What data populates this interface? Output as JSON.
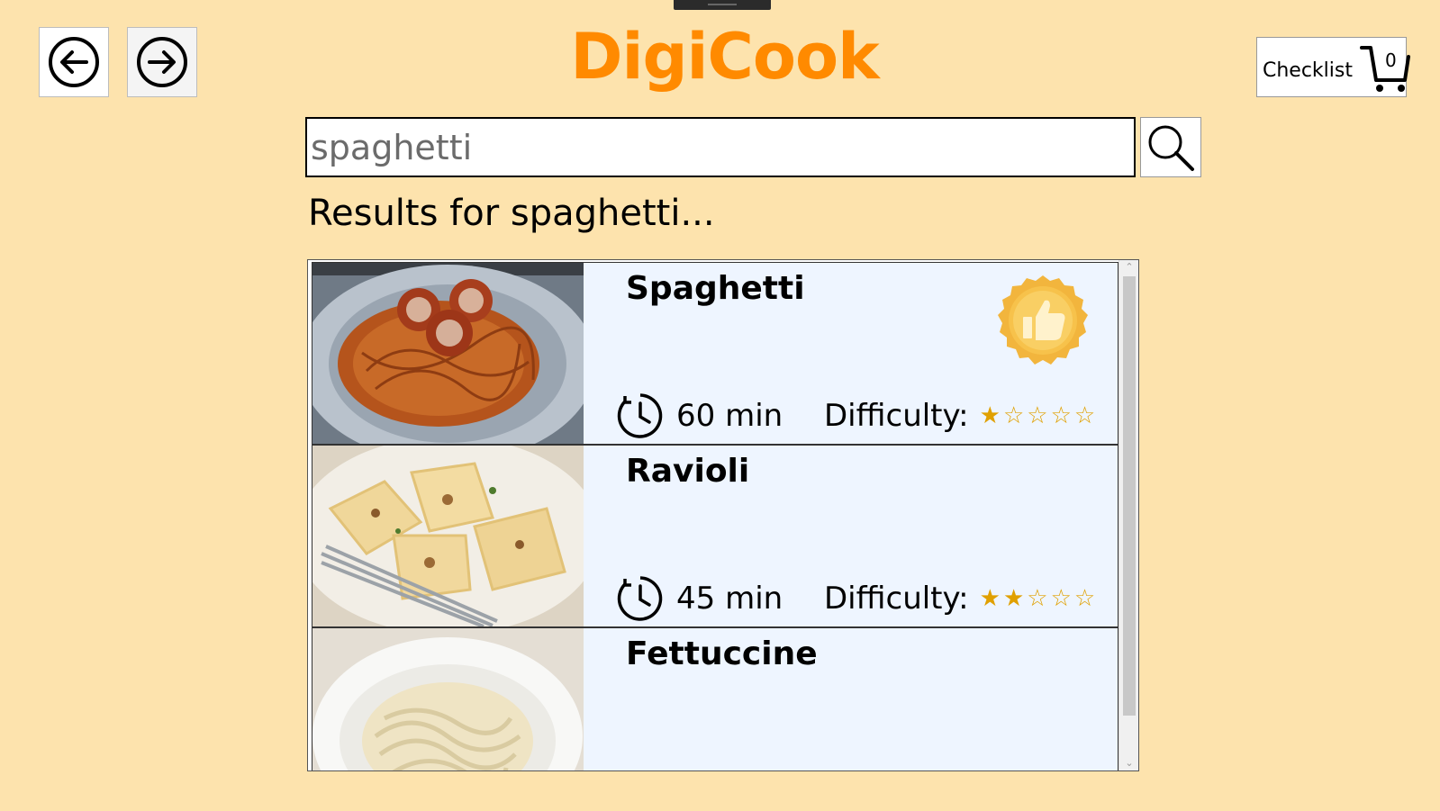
{
  "app": {
    "title": "DigiCook"
  },
  "nav": {
    "back_icon": "arrow-left-circle-icon",
    "forward_icon": "arrow-right-circle-icon"
  },
  "checklist": {
    "label": "Checklist",
    "count": "0",
    "icon": "shopping-cart-icon"
  },
  "search": {
    "value": "spaghetti",
    "placeholder": "spaghetti",
    "icon": "magnifier-icon"
  },
  "results": {
    "heading": "Results for spaghetti...",
    "items": [
      {
        "name": "Spaghetti",
        "time": "60 min",
        "difficulty_label": "Difficulty:",
        "difficulty": 1,
        "difficulty_max": 5,
        "badge": "thumbs-up-badge-icon",
        "image": "spaghetti-meatballs-photo"
      },
      {
        "name": "Ravioli",
        "time": "45 min",
        "difficulty_label": "Difficulty:",
        "difficulty": 2,
        "difficulty_max": 5,
        "image": "ravioli-photo"
      },
      {
        "name": "Fettuccine",
        "image": "fettuccine-photo"
      }
    ]
  },
  "colors": {
    "background": "#fde3ad",
    "title": "#ff8a00",
    "card": "#eef5ff",
    "star": "#e0a000",
    "badge": "#f4b63c"
  }
}
